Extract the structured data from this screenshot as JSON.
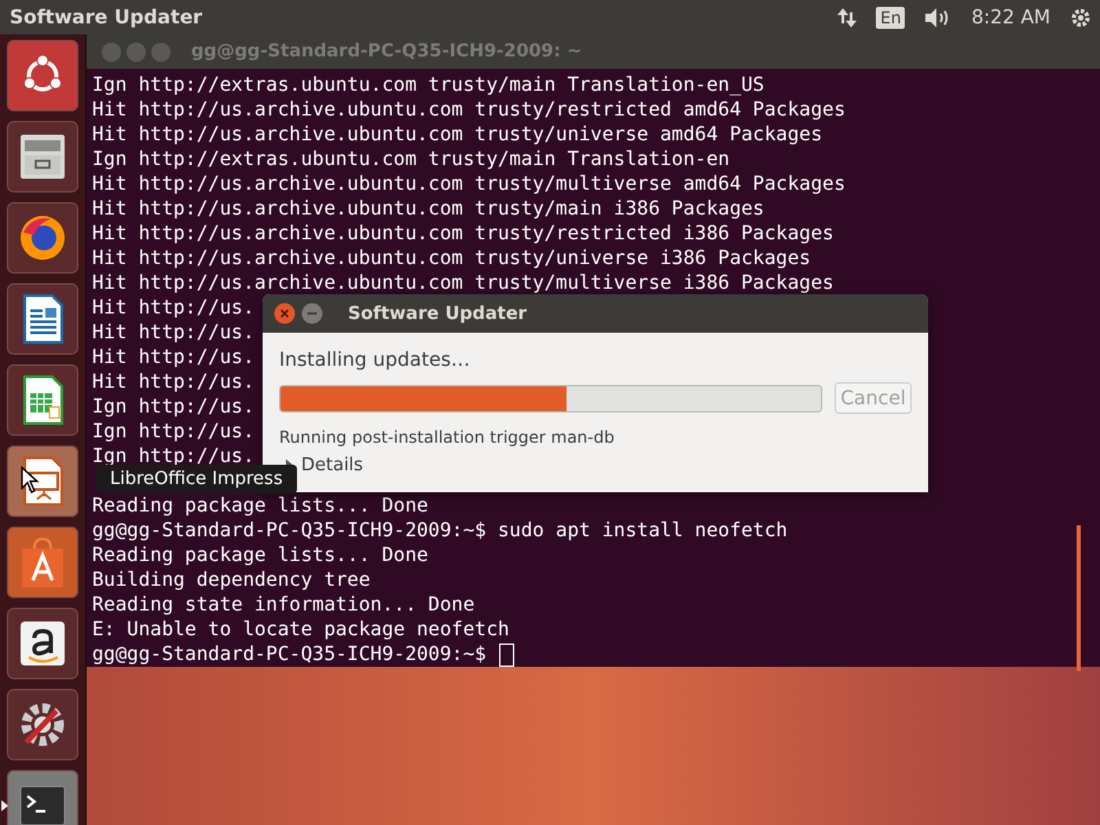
{
  "top_panel": {
    "app_title": "Software Updater",
    "keyboard_layout": "En",
    "clock": "8:22 AM"
  },
  "launcher": {
    "items": [
      {
        "kind": "dash",
        "running": false
      },
      {
        "kind": "files",
        "running": false
      },
      {
        "kind": "browser",
        "running": false
      },
      {
        "kind": "writer",
        "running": false
      },
      {
        "kind": "calc",
        "running": false
      },
      {
        "kind": "impress",
        "running": false
      },
      {
        "kind": "store",
        "running": false
      },
      {
        "kind": "amazon",
        "running": false
      },
      {
        "kind": "settings",
        "running": false
      },
      {
        "kind": "terminal",
        "running": true
      }
    ],
    "tooltip": "LibreOffice Impress"
  },
  "terminal": {
    "title": "gg@gg-Standard-PC-Q35-ICH9-2009: ~",
    "lines": [
      {
        "text": "Ign http://extras.ubuntu.com trusty/main Translation-en_US",
        "spaced": false
      },
      {
        "text": "Hit http://us.archive.ubuntu.com trusty/restricted amd64 Packages",
        "spaced": false
      },
      {
        "text": "Hit http://us.archive.ubuntu.com trusty/universe amd64 Packages",
        "spaced": false
      },
      {
        "text": "Ign http://extras.ubuntu.com trusty/main Translation-en",
        "spaced": false
      },
      {
        "text": "Hit http://us.archive.ubuntu.com trusty/multiverse amd64 Packages",
        "spaced": false
      },
      {
        "text": "Hit http://us.archive.ubuntu.com trusty/main i386 Packages",
        "spaced": false
      },
      {
        "text": "Hit http://us.archive.ubuntu.com trusty/restricted i386 Packages",
        "spaced": false
      },
      {
        "text": "Hit http://us.archive.ubuntu.com trusty/universe i386 Packages",
        "spaced": false
      },
      {
        "text": "Hit http://us.archive.ubuntu.com trusty/multiverse i386 Packages",
        "spaced": false
      },
      {
        "text": "Hit http://us.",
        "spaced": false
      },
      {
        "text": "Hit http://us.",
        "spaced": false
      },
      {
        "text": "Hit http://us.",
        "spaced": false
      },
      {
        "text": "Hit http://us.",
        "spaced": false
      },
      {
        "text": "Ign http://us.",
        "spaced": false
      },
      {
        "text": "Ign http://us.",
        "spaced": false
      },
      {
        "text": "Ign http://us.",
        "spaced": false
      },
      {
        "text": "Reading package lists... Done",
        "spaced": true
      },
      {
        "text": "gg@gg-Standard-PC-Q35-ICH9-2009:~$ sudo apt install neofetch",
        "spaced": false
      },
      {
        "text": "Reading package lists... Done",
        "spaced": false
      },
      {
        "text": "Building dependency tree",
        "spaced": false
      },
      {
        "text": "Reading state information... Done",
        "spaced": false
      },
      {
        "text": "E: Unable to locate package neofetch",
        "spaced": false
      },
      {
        "text": "gg@gg-Standard-PC-Q35-ICH9-2009:~$",
        "spaced": false,
        "cursor": true
      }
    ]
  },
  "dialog": {
    "title": "Software Updater",
    "heading": "Installing updates…",
    "progress": {
      "level": 0.53
    },
    "cancel_button": {
      "label": "Cancel",
      "disabled": true
    },
    "status": "Running post-installation trigger man-db",
    "details": {
      "label": "Details",
      "expanded": false
    }
  }
}
